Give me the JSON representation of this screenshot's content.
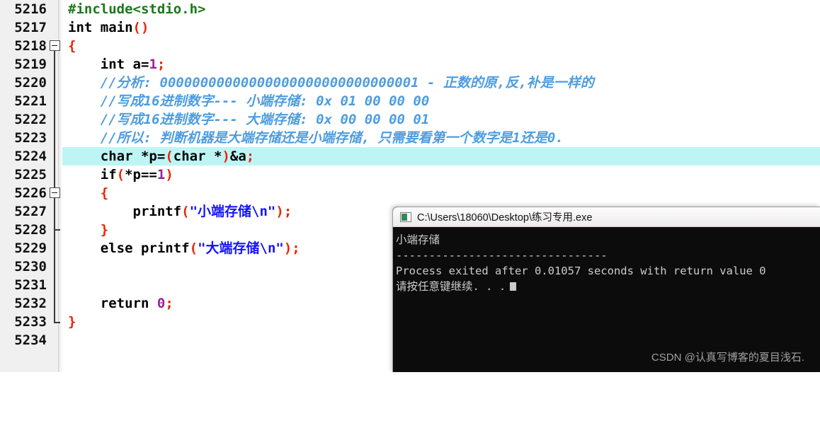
{
  "editor": {
    "first_line_number": 5216,
    "highlighted_line_number": 5224,
    "gutter_bg": "#f0f0f0",
    "highlight_color": "#bdf5f5",
    "lines": [
      {
        "no": "5216",
        "fold": "none"
      },
      {
        "no": "5217",
        "fold": "none"
      },
      {
        "no": "5218",
        "fold": "box"
      },
      {
        "no": "5219",
        "fold": "line"
      },
      {
        "no": "5220",
        "fold": "line"
      },
      {
        "no": "5221",
        "fold": "line"
      },
      {
        "no": "5222",
        "fold": "line"
      },
      {
        "no": "5223",
        "fold": "line"
      },
      {
        "no": "5224",
        "fold": "line"
      },
      {
        "no": "5225",
        "fold": "line"
      },
      {
        "no": "5226",
        "fold": "box2"
      },
      {
        "no": "5227",
        "fold": "line"
      },
      {
        "no": "5228",
        "fold": "tick"
      },
      {
        "no": "5229",
        "fold": "line"
      },
      {
        "no": "5230",
        "fold": "line"
      },
      {
        "no": "5231",
        "fold": "line"
      },
      {
        "no": "5232",
        "fold": "line"
      },
      {
        "no": "5233",
        "fold": "corner"
      },
      {
        "no": "5234",
        "fold": "none"
      }
    ],
    "code": {
      "l5216_include": "#include<stdio.h>",
      "l5217_int": "int",
      "l5217_main": "main",
      "l5217_parens": "()",
      "l5218_brace": "{",
      "l5219_int": "int",
      "l5219_a": "a=",
      "l5219_num": "1",
      "l5219_semi": ";",
      "l5220_comment": "//分析: 00000000000000000000000000000001 - 正数的原,反,补是一样的",
      "l5221_comment": "//写成16进制数字--- 小端存储: 0x 01 00 00 00",
      "l5222_comment": "//写成16进制数字--- 大端存储: 0x 00 00 00 01",
      "l5223_comment": "//所以: 判断机器是大端存储还是小端存储, 只需要看第一个数字是1还是0.",
      "l5224_char1": "char",
      "l5224_p": "*p=",
      "l5224_lp": "(",
      "l5224_char2": "char",
      "l5224_star": "*",
      "l5224_rp": ")",
      "l5224_amp": "&a",
      "l5224_semi": ";",
      "l5225_if": "if",
      "l5225_lp": "(",
      "l5225_expr": "*p==",
      "l5225_num": "1",
      "l5225_rp": ")",
      "l5226_brace": "{",
      "l5227_printf": "printf",
      "l5227_lp": "(",
      "l5227_str": "\"小端存储\\n\"",
      "l5227_rp": ")",
      "l5227_semi": ";",
      "l5228_brace": "}",
      "l5229_else": "else",
      "l5229_printf": "printf",
      "l5229_lp": "(",
      "l5229_str": "\"大端存储\\n\"",
      "l5229_rp": ")",
      "l5229_semi": ";",
      "l5232_return": "return",
      "l5232_num": "0",
      "l5232_semi": ";",
      "l5233_brace": "}"
    }
  },
  "console": {
    "title": "C:\\Users\\18060\\Desktop\\练习专用.exe",
    "icon": "console-app-icon",
    "output_lines": [
      "小端存储",
      "",
      "--------------------------------",
      "Process exited after 0.01057 seconds with return value 0",
      "请按任意键继续. . ."
    ],
    "bg": "#0c0c0c",
    "fg": "#cccccc"
  },
  "watermark": {
    "text": "CSDN @认真写博客的夏目浅石."
  }
}
